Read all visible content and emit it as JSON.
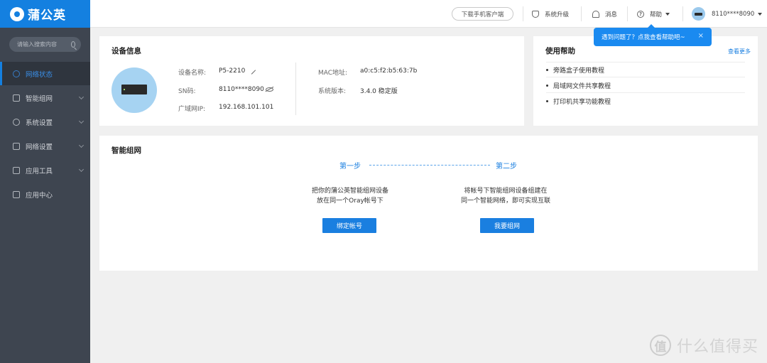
{
  "app": {
    "logo_text": "蒲公英",
    "brand_color": "#1480e0"
  },
  "sidebar": {
    "search_placeholder": "请输入搜索内容",
    "items": [
      {
        "label": "网络状态",
        "icon": "monitor-icon",
        "active": true
      },
      {
        "label": "智能组网",
        "icon": "network-icon",
        "expandable": true
      },
      {
        "label": "系统设置",
        "icon": "gear-icon",
        "expandable": true
      },
      {
        "label": "网络设置",
        "icon": "document-icon",
        "expandable": true
      },
      {
        "label": "应用工具",
        "icon": "toolbox-icon",
        "expandable": true
      },
      {
        "label": "应用中心",
        "icon": "cube-icon"
      }
    ]
  },
  "header": {
    "download_label": "下载手机客户端",
    "upgrade_label": "系统升级",
    "message_label": "消息",
    "help_label": "帮助",
    "account_label": "8110****8090"
  },
  "tooltip": {
    "text": "遇到问题了？点我查看帮助吧~",
    "close": "×"
  },
  "device_info": {
    "title": "设备信息",
    "name_label": "设备名称:",
    "name_value": "P5-2210",
    "sn_label": "SN码:",
    "sn_value": "8110****8090",
    "ip_label": "广域网IP:",
    "ip_value": "192.168.101.101",
    "mac_label": "MAC地址:",
    "mac_value": "a0:c5:f2:b5:63:7b",
    "version_label": "系统版本:",
    "version_value": "3.4.0 稳定版"
  },
  "help_card": {
    "title": "使用帮助",
    "more_label": "查看更多",
    "items": [
      "旁路盒子使用教程",
      "局域网文件共享教程",
      "打印机共享功能教程"
    ]
  },
  "smart_network": {
    "title": "智能组网",
    "step1_label": "第一步",
    "step2_label": "第二步",
    "step1_desc_line1": "把你的蒲公英智能组网设备",
    "step1_desc_line2": "放在同一个Oray帐号下",
    "step2_desc_line1": "将帐号下智能组网设备组建在",
    "step2_desc_line2": "同一个智能网络，即可实现互联",
    "step1_button": "绑定帐号",
    "step2_button": "我要组网"
  },
  "watermark": {
    "mark": "值",
    "text": "什么值得买"
  }
}
